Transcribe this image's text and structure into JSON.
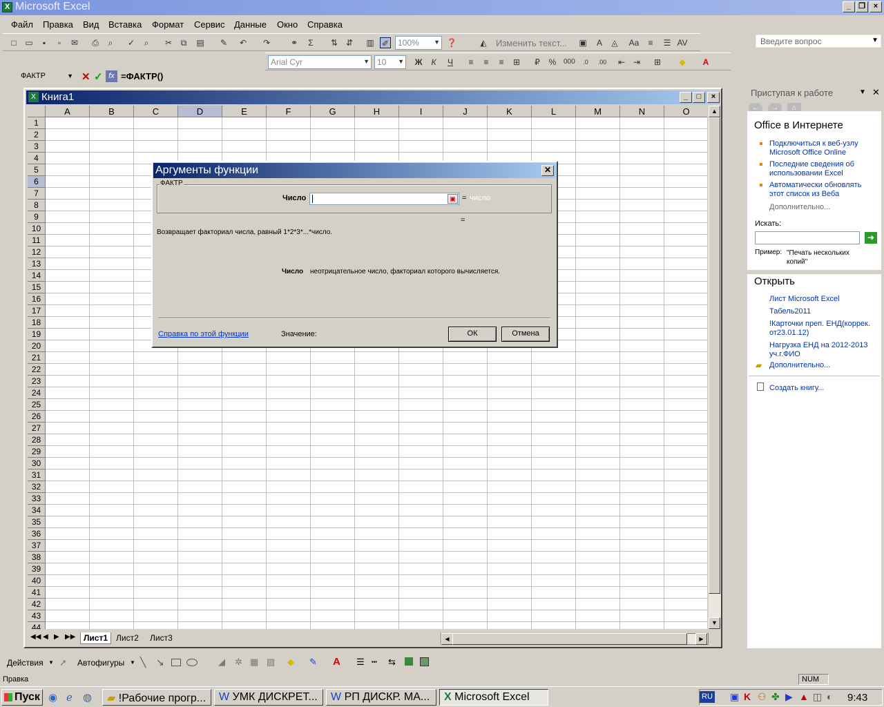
{
  "app": {
    "title": "Microsoft Excel"
  },
  "menu": [
    "Файл",
    "Правка",
    "Вид",
    "Вставка",
    "Формат",
    "Сервис",
    "Данные",
    "Окно",
    "Справка"
  ],
  "help_box": {
    "placeholder": "Введите вопрос"
  },
  "toolbar1": {
    "zoom": "100%",
    "edit_text": "Изменить текст..."
  },
  "toolbar2": {
    "font": "Arial Cyr",
    "size": "10"
  },
  "formula": {
    "namebox": "ФАКТР",
    "content": "=ФАКТР()"
  },
  "workbook": {
    "title": "Книга1",
    "columns": [
      "A",
      "B",
      "C",
      "D",
      "E",
      "F",
      "G",
      "H",
      "I",
      "J",
      "K",
      "L",
      "M",
      "N",
      "O"
    ],
    "rows": [
      "1",
      "2",
      "3",
      "4",
      "5",
      "6",
      "7",
      "8",
      "9",
      "10",
      "11",
      "12",
      "13",
      "14",
      "15",
      "16",
      "17",
      "18",
      "19",
      "20",
      "21",
      "22",
      "23",
      "24",
      "25",
      "26",
      "27",
      "28",
      "29",
      "30",
      "31",
      "32",
      "33",
      "34",
      "35",
      "36",
      "37",
      "38",
      "39",
      "40",
      "41",
      "42",
      "43",
      "44"
    ],
    "sheets": [
      "Лист1",
      "Лист2",
      "Лист3"
    ]
  },
  "dialog": {
    "title": "Аргументы функции",
    "group_label": "ФАКТР",
    "arg_label": "Число",
    "arg_hint": "число",
    "eq": "=",
    "description": "Возвращает факториал числа, равный 1*2*3*...*число.",
    "arg_desc_name": "Число",
    "arg_desc_text": "неотрицательное число, факториал которого вычисляется.",
    "help_link": "Справка по этой функции",
    "value_label": "Значение:",
    "ok": "ОК",
    "cancel": "Отмена"
  },
  "taskpane": {
    "title": "Приступая к работе",
    "section1": "Office в Интернете",
    "links1": [
      [
        "Подключиться к веб-узлу",
        "Microsoft Office Online"
      ],
      [
        "Последние сведения об",
        "использовании Excel"
      ],
      [
        "Автоматически обновлять",
        "этот список из Веба"
      ]
    ],
    "more1": "Дополнительно...",
    "search_label": "Искать:",
    "example_label": "Пример:",
    "example_text1": "\"Печать нескольких",
    "example_text2": "копий\"",
    "section2": "Открыть",
    "files": [
      [
        "Лист Microsoft Excel"
      ],
      [
        "Табель2011"
      ],
      [
        "!Карточки преп. ЕНД(коррек.",
        "от23.01.12)"
      ],
      [
        "Нагрузка ЕНД на 2012-2013",
        "уч.г.ФИО"
      ]
    ],
    "more2": "Дополнительно...",
    "create": "Создать книгу..."
  },
  "drawbar": {
    "actions": "Действия",
    "autoshapes": "Автофигуры"
  },
  "status": {
    "left": "Правка",
    "num": "NUM"
  },
  "taskbar": {
    "start": "Пуск",
    "tasks": [
      "!Рабочие прогр...",
      "УМК ДИСКРЕТ...",
      "РП ДИСКР. МА...",
      "Microsoft Excel"
    ],
    "lang": "RU",
    "time": "9:43"
  }
}
